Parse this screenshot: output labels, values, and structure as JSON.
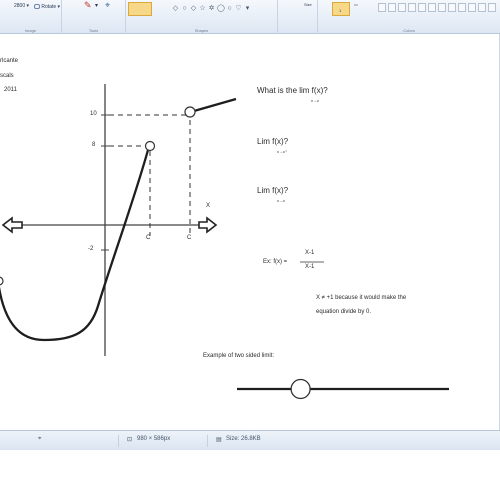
{
  "ribbon": {
    "zoom_label": "2800",
    "rotate_label": "Rotate",
    "group_image": "Image",
    "group_tools": "Tools",
    "group_shapes": "Shapes",
    "group_colors": "Colors",
    "size_label": "Size",
    "color1_label": "Color 1",
    "color1_sub": "1"
  },
  "notes": {
    "line1": "rlcante",
    "line2": "scals",
    "line3": "2011"
  },
  "graph": {
    "y_tick_10": "10",
    "y_tick_8": "8",
    "y_tick_neg2": "-2",
    "x_label": "X",
    "x_tick_c1": "C",
    "x_tick_c2": "C"
  },
  "questions": {
    "q1": "What is the lim f(x)?",
    "q1_sub": "x→c",
    "q2": "Lim f(x)?",
    "q2_sub": "x→c⁺",
    "q3": "Lim f(x)?",
    "q3_sub": "x→c",
    "example_prefix": "Ex: f(x) =",
    "numerator": "X-1",
    "denominator": "X-1",
    "explain_line1": "X ≠ +1 because it would make the",
    "explain_line2": "equation divide by 0."
  },
  "slider_caption": "Example of two sided limit:",
  "slider_value": 0.3,
  "status": {
    "pixel_icon": "pointer-position-icon",
    "dimensions": "980 × 586px",
    "file_size": "Size: 26.8KB"
  },
  "colors": {
    "ribbon_top": "#f5f8fc",
    "ribbon_bottom": "#dde7f3",
    "accent": "#f7d889",
    "ink": "#2b2b2b"
  }
}
